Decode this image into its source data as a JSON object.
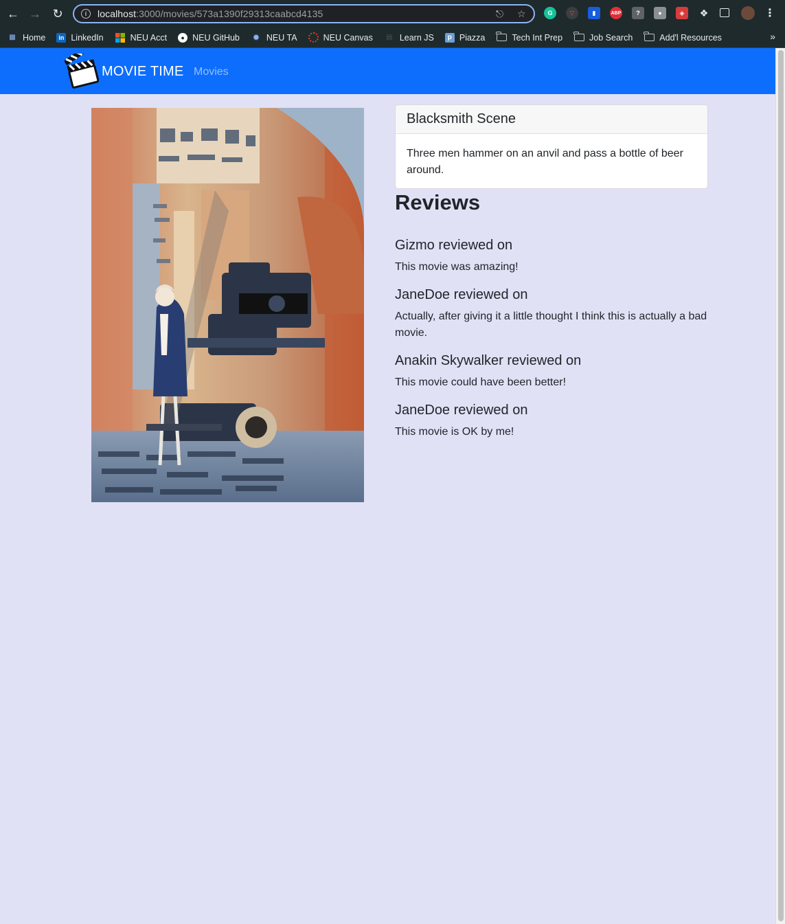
{
  "browser": {
    "url_host": "localhost",
    "url_path": ":3000/movies/573a1390f29313caabcd4135",
    "bookmarks": [
      {
        "label": "Home",
        "icon": "home-building-icon",
        "color": "#8ab4f8"
      },
      {
        "label": "LinkedIn",
        "icon": "linkedin-icon",
        "color": "#0a66c2"
      },
      {
        "label": "NEU Acct",
        "icon": "microsoft-icon",
        "color": "#f25022"
      },
      {
        "label": "NEU GitHub",
        "icon": "github-icon",
        "color": "#ffffff"
      },
      {
        "label": "NEU TA",
        "icon": "ta-icon",
        "color": "#8ab4f8"
      },
      {
        "label": "NEU Canvas",
        "icon": "canvas-icon",
        "color": "#e13f2b"
      },
      {
        "label": "Learn JS",
        "icon": "learnjs-icon",
        "color": "#3c4043"
      },
      {
        "label": "Piazza",
        "icon": "piazza-icon",
        "color": "#6a9fd4"
      },
      {
        "label": "Tech Int Prep",
        "icon": "folder-icon"
      },
      {
        "label": "Job Search",
        "icon": "folder-icon"
      },
      {
        "label": "Add'l Resources",
        "icon": "folder-icon"
      }
    ]
  },
  "navbar": {
    "brand": "MOVIE TIME",
    "links": [
      "Movies"
    ],
    "color": "#0d6efd"
  },
  "movie": {
    "title": "Blacksmith Scene",
    "plot": "Three men hammer on an anvil and pass a bottle of beer around."
  },
  "reviews": {
    "heading": "Reviews",
    "items": [
      {
        "header": "Gizmo reviewed on",
        "text": "This movie was amazing!"
      },
      {
        "header": "JaneDoe reviewed on",
        "text": "Actually, after giving it a little thought I think this is actually a bad movie."
      },
      {
        "header": "Anakin Skywalker reviewed on",
        "text": "This movie could have been better!"
      },
      {
        "header": "JaneDoe reviewed on",
        "text": "This movie is OK by me!"
      }
    ]
  }
}
